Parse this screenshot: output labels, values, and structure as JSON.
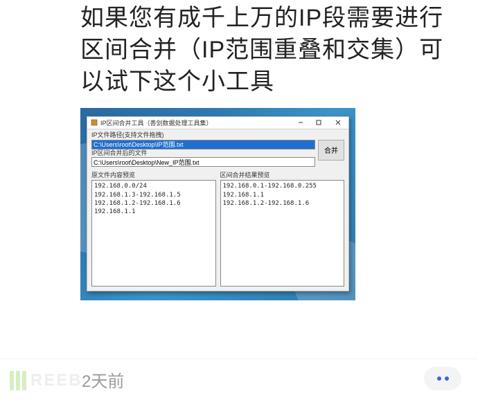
{
  "heading": "如果您有成千上万的IP段需要进行区间合并（IP范围重叠和交集）可以试下这个小工具",
  "window": {
    "title": "IP区间合并工具（善剑数据处理工具集）",
    "path_label": "IP文件路径(支持文件拖拽)",
    "path_value": "C:\\Users\\root\\Desktop\\IP范围.txt",
    "out_label": "IP区间合并后的文件",
    "out_value": "C:\\Users\\root\\Desktop\\New_IP范围.txt",
    "merge_btn": "合并",
    "left_h": "原文件内容预览",
    "right_h": "区间合并结果预览",
    "left_lines": "192.168.0.0/24\n192.168.1.3-192.168.1.5\n192.168.1.2-192.168.1.6\n192.168.1.1",
    "right_lines": "192.168.0.1-192.168.0.255\n192.168.1.1\n192.168.1.2-192.168.1.6"
  },
  "footer": {
    "logo_text": "REEB",
    "timestamp": "2天前"
  }
}
